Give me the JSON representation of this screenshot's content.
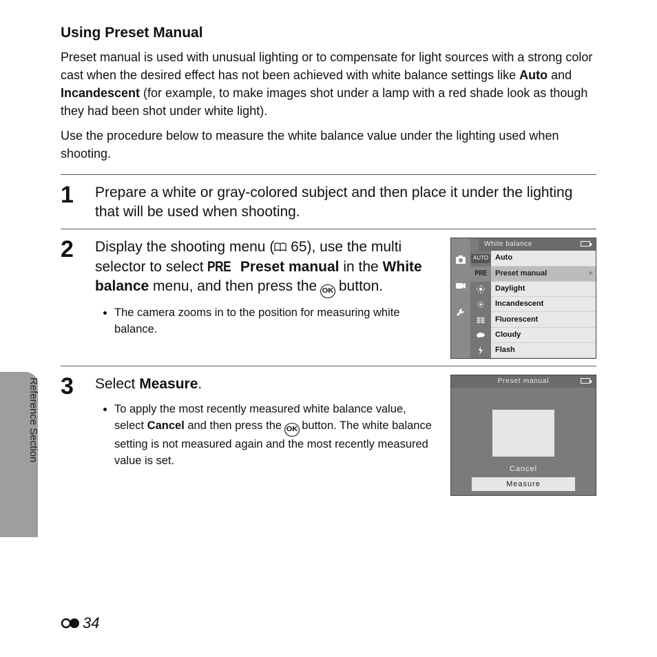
{
  "sideLabel": "Reference Section",
  "title": "Using Preset Manual",
  "intro": {
    "p1_a": "Preset manual is used with unusual lighting or to compensate for light sources with a strong color cast when the desired effect has not been achieved with white balance settings like ",
    "p1_b_bold": "Auto",
    "p1_c": " and ",
    "p1_d_bold": "Incandescent",
    "p1_e": " (for example, to make images shot under a lamp with a red shade look as though they had been shot under white light).",
    "p2": "Use the procedure below to measure the white balance value under the lighting used when shooting."
  },
  "steps": {
    "s1": {
      "num": "1",
      "text": "Prepare a white or gray-colored subject and then place it under the lighting that will be used when shooting."
    },
    "s2": {
      "num": "2",
      "main_a": "Display the shooting menu (",
      "main_ref": " 65), use the multi selector to select ",
      "pre": "PRE",
      "main_b_bold": " Preset manual",
      "main_c": " in the ",
      "main_d_bold": "White balance",
      "main_e": " menu, and then press the ",
      "main_f": " button.",
      "bullet": "The camera zooms in to the position for measuring white balance."
    },
    "s3": {
      "num": "3",
      "main_a": "Select ",
      "main_b_bold": "Measure",
      "main_c": ".",
      "bullet_a": "To apply the most recently measured white balance value, select ",
      "bullet_b_bold": "Cancel",
      "bullet_c": " and then press the ",
      "bullet_d": " button. The white balance setting is not measured again and the most recently measured value is set."
    }
  },
  "screen1": {
    "title": "White balance",
    "items": {
      "auto": "Auto",
      "preset": "Preset manual",
      "daylight": "Daylight",
      "incandescent": "Incandescent",
      "fluorescent": "Fluorescent",
      "cloudy": "Cloudy",
      "flash": "Flash"
    },
    "iconLabels": {
      "auto": "AUTO",
      "pre": "PRE"
    }
  },
  "screen2": {
    "title": "Preset manual",
    "cancel": "Cancel",
    "measure": "Measure"
  },
  "pageNum": "34",
  "ok": "OK"
}
